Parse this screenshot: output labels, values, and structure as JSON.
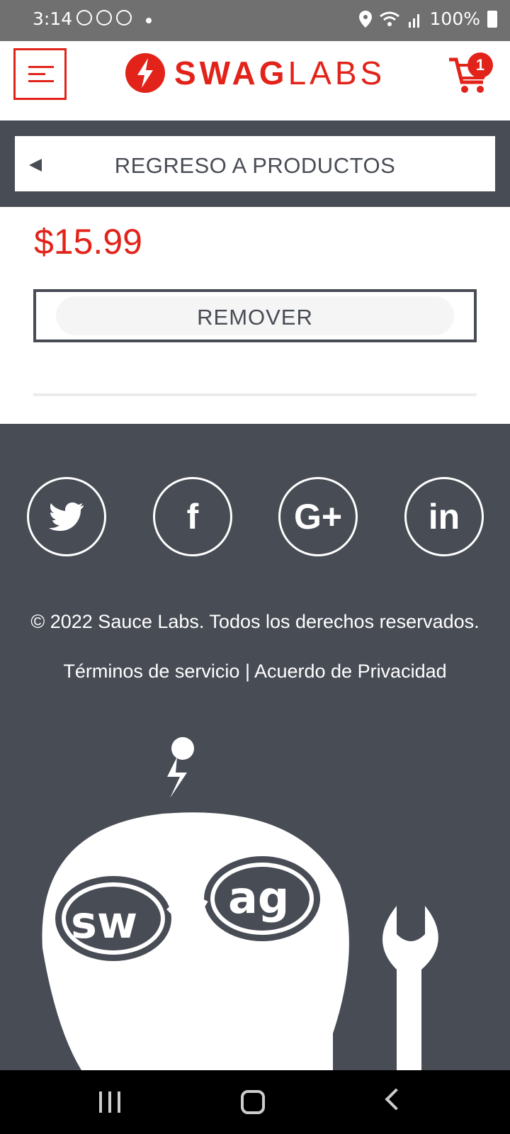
{
  "status_bar": {
    "time": "3:14",
    "battery": "100%"
  },
  "header": {
    "logo_bold": "SWAG",
    "logo_light": "LABS",
    "cart_count": "1",
    "accent_color": "#e2231a"
  },
  "back": {
    "label": "REGRESO A PRODUCTOS"
  },
  "product": {
    "price": "$15.99",
    "remove_label": "REMOVER"
  },
  "footer": {
    "social": [
      {
        "icon": "twitter-icon"
      },
      {
        "icon": "facebook-icon",
        "glyph": "f"
      },
      {
        "icon": "google-plus-icon",
        "glyph": "G+"
      },
      {
        "icon": "linkedin-icon",
        "glyph": "in"
      }
    ],
    "copyright": "© 2022 Sauce Labs. Todos los derechos reservados.",
    "terms": "Términos de servicio | Acuerdo de Privacidad",
    "mascot_text_left": "sw",
    "mascot_text_right": "ag"
  },
  "colors": {
    "dark": "#484c55",
    "red": "#e2231a"
  }
}
